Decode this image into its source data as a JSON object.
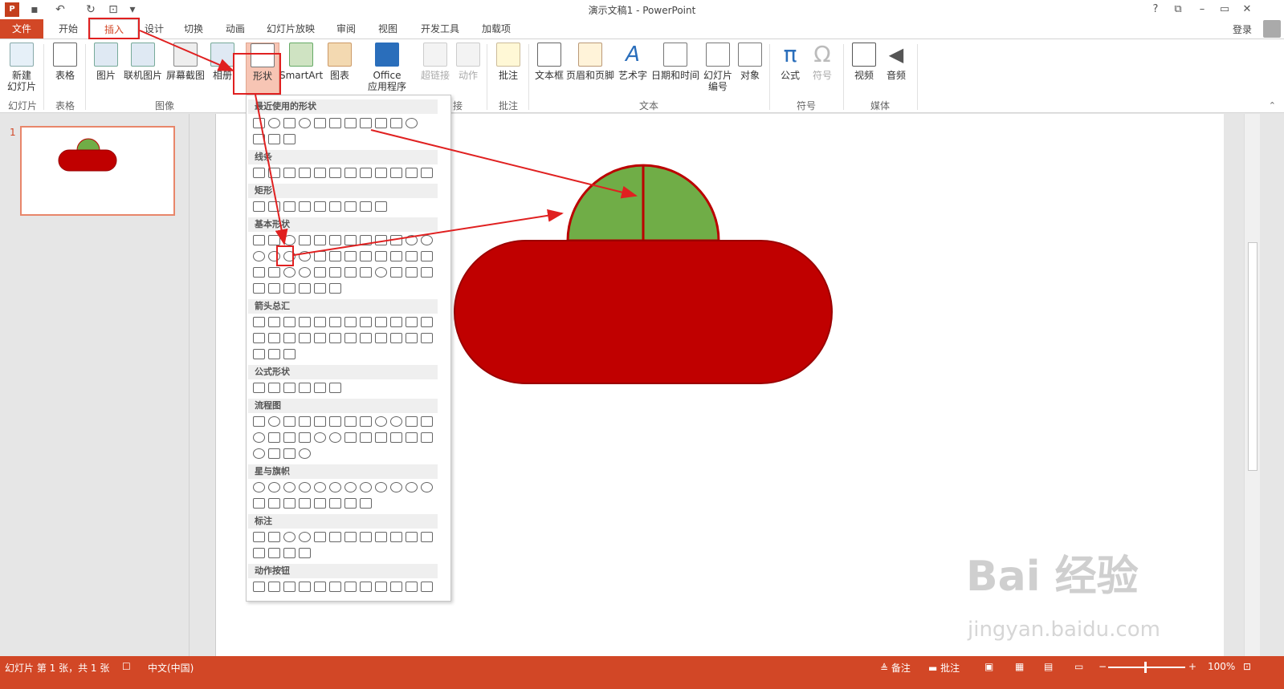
{
  "titlebar": {
    "title": "演示文稿1 - PowerPoint",
    "help": "?",
    "restore": "⧉",
    "minimize": "–",
    "maximize": "▭",
    "close": "✕"
  },
  "tabs": [
    {
      "label": "文件"
    },
    {
      "label": "开始"
    },
    {
      "label": "插入"
    },
    {
      "label": "设计"
    },
    {
      "label": "切换"
    },
    {
      "label": "动画"
    },
    {
      "label": "幻灯片放映"
    },
    {
      "label": "审阅"
    },
    {
      "label": "视图"
    },
    {
      "label": "开发工具"
    },
    {
      "label": "加载项"
    }
  ],
  "login": "登录",
  "ribbon": {
    "buttons": [
      {
        "label": "新建",
        "label2": "幻灯片"
      },
      {
        "label": "表格"
      },
      {
        "label": "图片"
      },
      {
        "label": "联机图片"
      },
      {
        "label": "屏幕截图"
      },
      {
        "label": "相册"
      },
      {
        "label": "形状"
      },
      {
        "label": "SmartArt"
      },
      {
        "label": "图表"
      },
      {
        "label": "Office",
        "label2": "应用程序"
      },
      {
        "label": "超链接"
      },
      {
        "label": "动作"
      },
      {
        "label": "批注"
      },
      {
        "label": "文本框"
      },
      {
        "label": "页眉和页脚"
      },
      {
        "label": "艺术字"
      },
      {
        "label": "日期和时间"
      },
      {
        "label": "幻灯片",
        "label2": "编号"
      },
      {
        "label": "对象"
      },
      {
        "label": "公式"
      },
      {
        "label": "符号"
      },
      {
        "label": "视频"
      },
      {
        "label": "音频"
      }
    ],
    "groups": [
      "幻灯片",
      "表格",
      "图像",
      "接",
      "批注",
      "文本",
      "符号",
      "媒体"
    ]
  },
  "shapes_menu": {
    "categories": [
      "最近使用的形状",
      "线条",
      "矩形",
      "基本形状",
      "箭头总汇",
      "公式形状",
      "流程图",
      "星与旗帜",
      "标注",
      "动作按钮"
    ]
  },
  "thumbnail": {
    "number": "1"
  },
  "statusbar": {
    "slide_info": "幻灯片 第 1 张，共 1 张",
    "language": "中文(中国)",
    "notes": "备注",
    "comments": "批注",
    "zoom": "100%"
  },
  "watermark": {
    "main": "Bai 经验",
    "url": "jingyan.baidu.com"
  },
  "colors": {
    "accent": "#d24726",
    "shape_red": "#c00000",
    "shape_green": "#70ad47",
    "highlight_box": "#e02020"
  }
}
